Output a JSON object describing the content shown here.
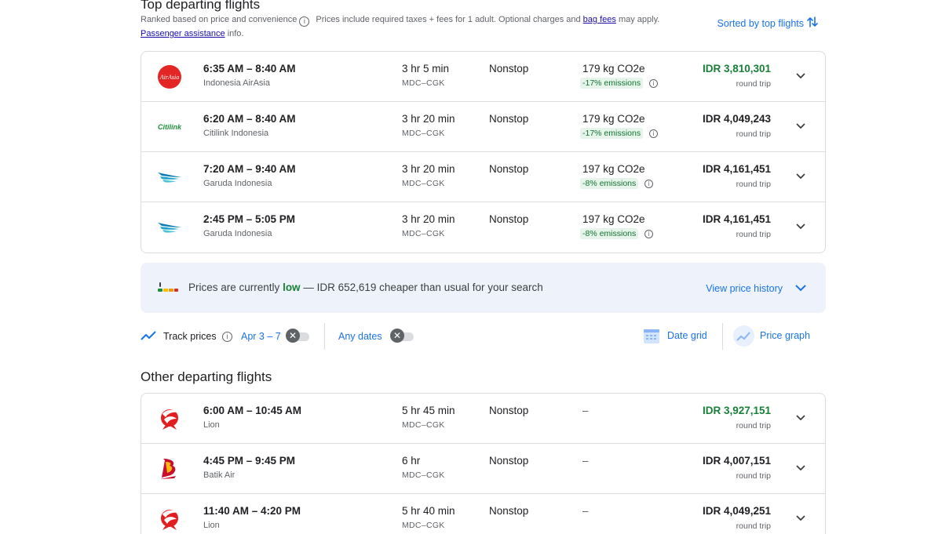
{
  "top_section": {
    "title": "Top departing flights",
    "ranked_text": "Ranked based on price and convenience",
    "info_glyph": "i",
    "prices_note_prefix": "Prices include required taxes + fees for 1 adult. Optional charges and",
    "bag_fees_link": "bag fees",
    "prices_note_suffix": "may apply.",
    "passenger_link": "Passenger assistance",
    "passenger_suffix": "info.",
    "sorted_label": "Sorted by top flights"
  },
  "top_flights": [
    {
      "times": "6:35 AM – 8:40 AM",
      "airline": "Indonesia AirAsia",
      "duration": "3 hr 5 min",
      "route": "MDC–CGK",
      "stops": "Nonstop",
      "co2": "179 kg CO2e",
      "emissions": "-17% emissions",
      "price": "IDR 3,810,301",
      "price_note": "round trip",
      "logo": "airasia-logo"
    },
    {
      "times": "6:20 AM – 8:40 AM",
      "airline": "Citilink Indonesia",
      "duration": "3 hr 20 min",
      "route": "MDC–CGK",
      "stops": "Nonstop",
      "co2": "179 kg CO2e",
      "emissions": "-17% emissions",
      "price": "IDR 4,049,243",
      "price_note": "round trip",
      "logo": "citilink-logo",
      "logo_text": "Citilink"
    },
    {
      "times": "7:20 AM – 9:40 AM",
      "airline": "Garuda Indonesia",
      "duration": "3 hr 20 min",
      "route": "MDC–CGK",
      "stops": "Nonstop",
      "co2": "197 kg CO2e",
      "emissions": "-8% emissions",
      "price": "IDR 4,161,451",
      "price_note": "round trip",
      "logo": "garuda-logo"
    },
    {
      "times": "2:45 PM – 5:05 PM",
      "airline": "Garuda Indonesia",
      "duration": "3 hr 20 min",
      "route": "MDC–CGK",
      "stops": "Nonstop",
      "co2": "197 kg CO2e",
      "emissions": "-8% emissions",
      "price": "IDR 4,161,451",
      "price_note": "round trip",
      "logo": "garuda-logo"
    }
  ],
  "insight": {
    "prefix": "Prices are currently",
    "level": "low",
    "suffix": "— IDR 652,619 cheaper than usual for your search",
    "link": "View price history"
  },
  "tracking": {
    "label": "Track prices",
    "info_glyph": "i",
    "dates": "Apr 3 – 7",
    "any_dates": "Any dates",
    "toggle_glyph": "✕",
    "date_grid": "Date grid",
    "price_graph": "Price graph"
  },
  "other_section": {
    "title": "Other departing flights"
  },
  "other_flights": [
    {
      "times": "6:00 AM – 10:45 AM",
      "airline": "Lion",
      "duration": "5 hr 45 min",
      "route": "MDC–CGK",
      "stops": "Nonstop",
      "co2": "–",
      "price": "IDR 3,927,151",
      "price_note": "round trip",
      "logo": "lion-logo"
    },
    {
      "times": "4:45 PM – 9:45 PM",
      "airline": "Batik Air",
      "duration": "6 hr",
      "route": "MDC–CGK",
      "stops": "Nonstop",
      "co2": "–",
      "price": "IDR 4,007,151",
      "price_note": "round trip",
      "logo": "batik-logo"
    },
    {
      "times": "11:40 AM – 4:20 PM",
      "airline": "Lion",
      "duration": "5 hr 40 min",
      "route": "MDC–CGK",
      "stops": "Nonstop",
      "co2": "–",
      "price": "IDR 4,049,251",
      "price_note": "round trip",
      "logo": "lion-logo"
    }
  ],
  "colors": {
    "accent": "#1a73e8",
    "good_price": "#188038",
    "emission_bg": "#e6f4ea"
  }
}
